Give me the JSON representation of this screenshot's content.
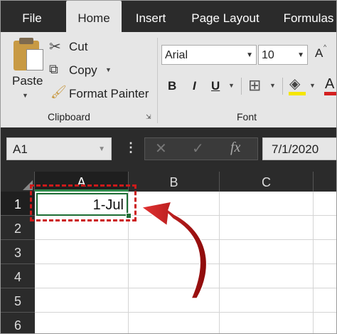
{
  "tabs": [
    {
      "label": "File",
      "active": false
    },
    {
      "label": "Home",
      "active": true
    },
    {
      "label": "Insert",
      "active": false
    },
    {
      "label": "Page Layout",
      "active": false
    },
    {
      "label": "Formulas",
      "active": false
    }
  ],
  "clipboard": {
    "paste_label": "Paste",
    "cut_label": "Cut",
    "copy_label": "Copy",
    "format_painter_label": "Format Painter",
    "group_label": "Clipboard"
  },
  "font": {
    "name": "Arial",
    "size": "10",
    "bold": "B",
    "italic": "I",
    "underline": "U",
    "group_label": "Font",
    "grow_glyph": "A",
    "font_color_glyph": "A"
  },
  "formula_bar": {
    "name_box": "A1",
    "fx_glyph": "fx",
    "value": "7/1/2020"
  },
  "grid": {
    "columns": [
      "A",
      "B",
      "C"
    ],
    "rows": [
      "1",
      "2",
      "3",
      "4",
      "5",
      "6"
    ],
    "selected_cell_value": "1-Jul"
  },
  "colors": {
    "dark_bg": "#2b2b2b",
    "ribbon_bg": "#e6e6e6",
    "selection_green": "#1e6e35",
    "highlight_red": "#cc1a1a"
  }
}
